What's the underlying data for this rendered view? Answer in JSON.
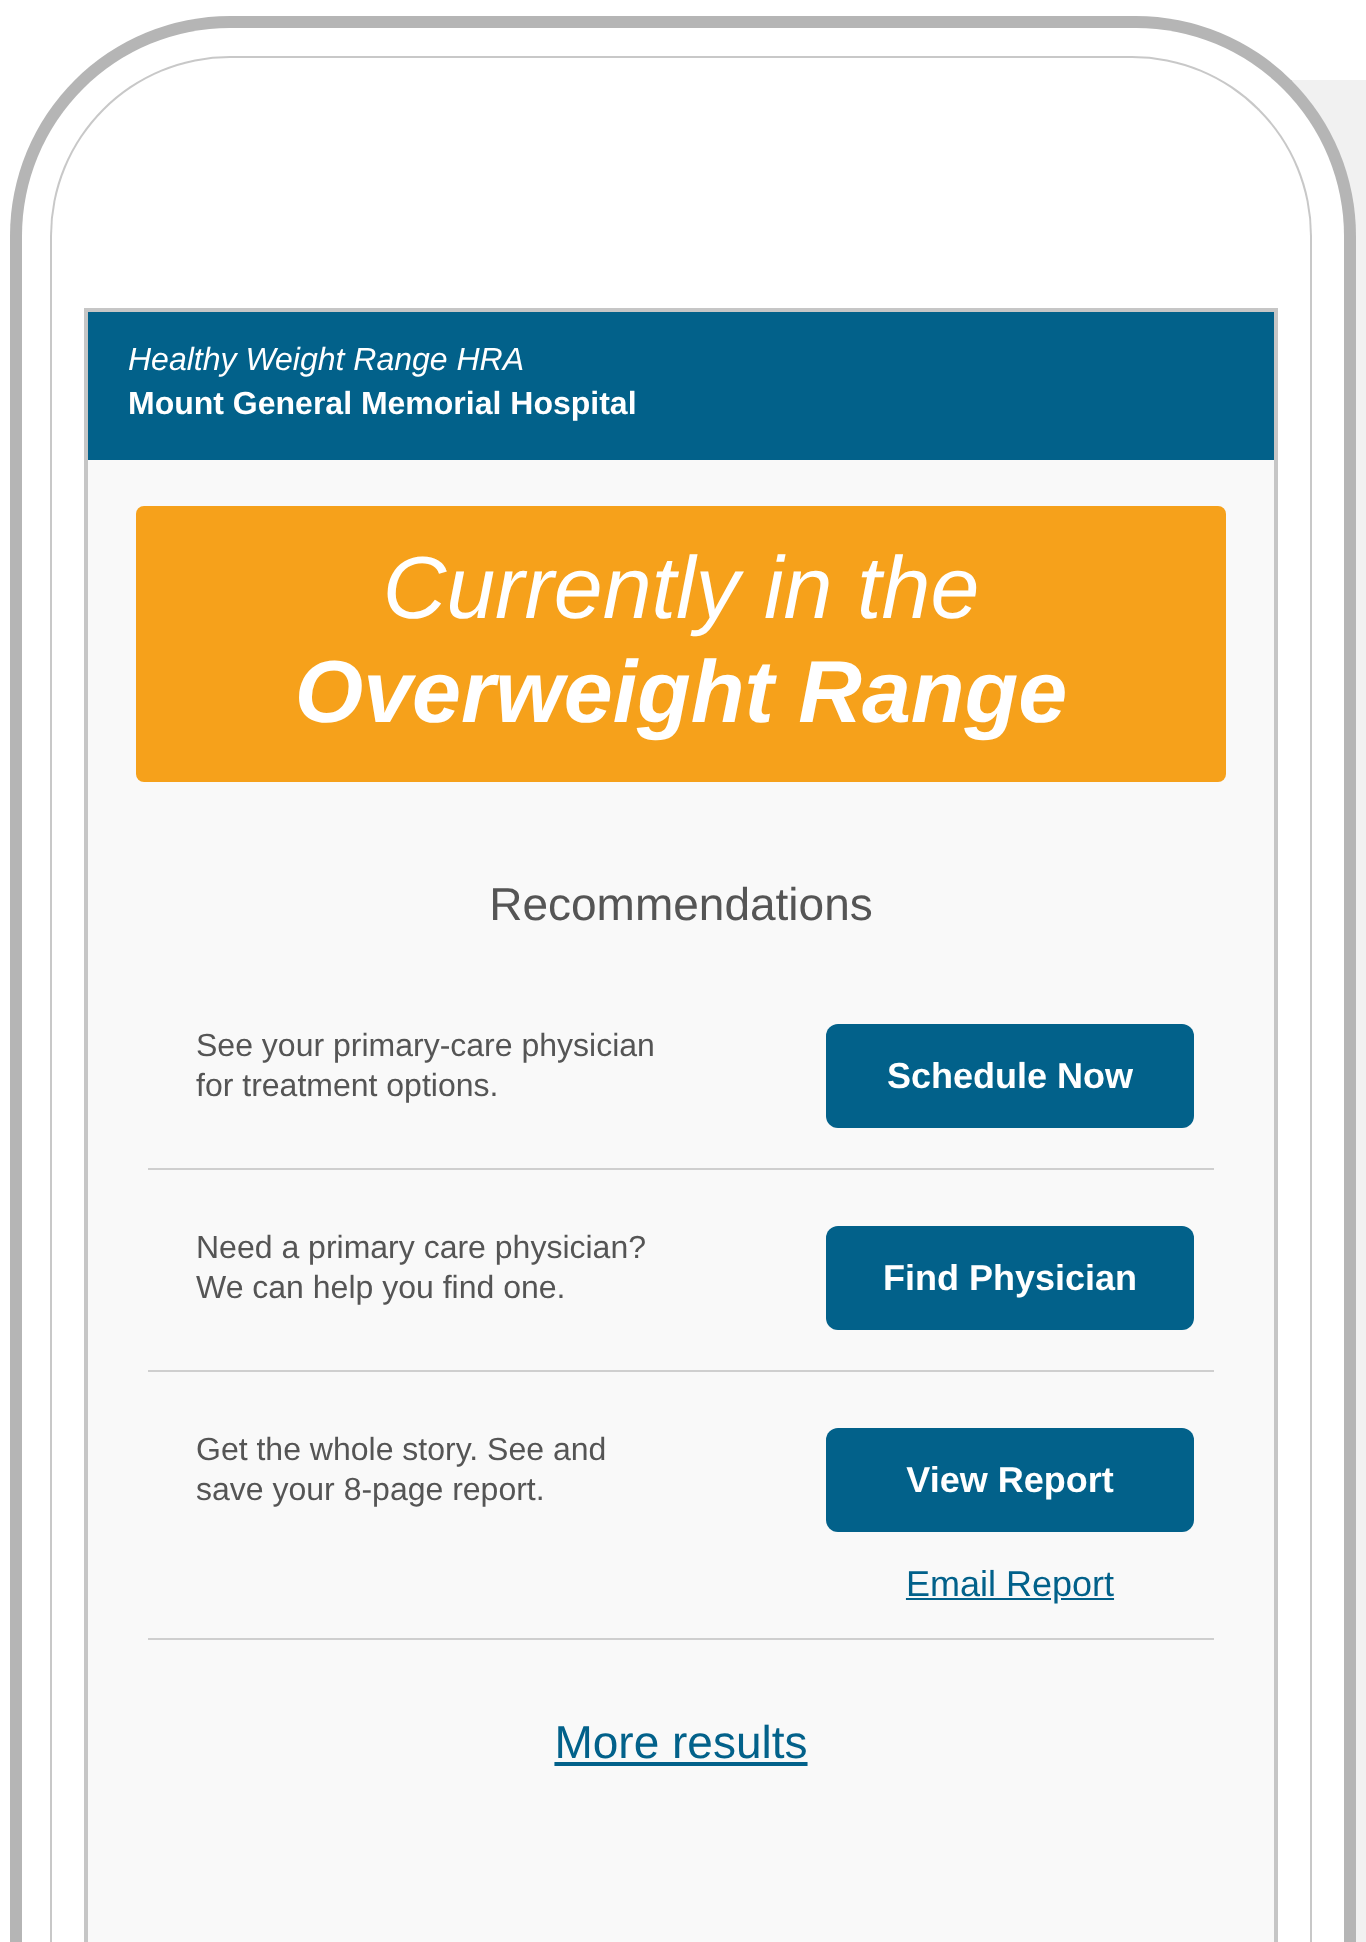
{
  "header": {
    "subtitle": "Healthy Weight Range HRA",
    "title": "Mount General Memorial Hospital"
  },
  "status_banner": {
    "prefix": "Currently in the",
    "range": "Overweight Range"
  },
  "section_title": "Recommendations",
  "recommendations": [
    {
      "text": "See your primary-care physician for treatment options.",
      "button": "Schedule Now"
    },
    {
      "text": "Need a primary care physician? We can help you find one.",
      "button": "Find Physician"
    },
    {
      "text": "Get the whole story. See and save your 8-page report.",
      "button": "View Report",
      "link": "Email Report"
    }
  ],
  "more_link": "More results"
}
